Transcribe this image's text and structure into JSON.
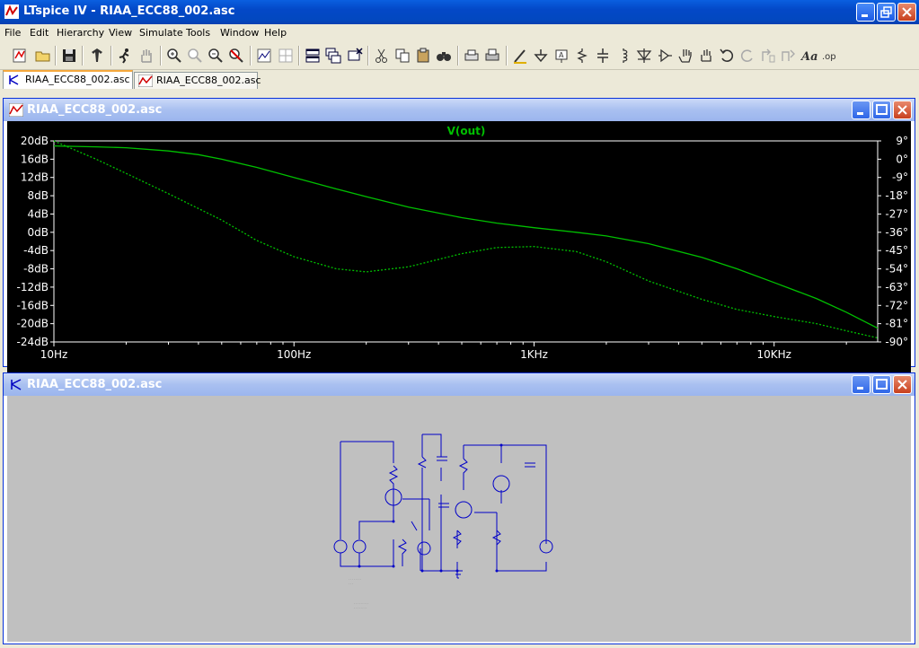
{
  "window": {
    "title": "LTspice IV - RIAA_ECC88_002.asc"
  },
  "menu": [
    "File",
    "Edit",
    "Hierarchy",
    "View",
    "Simulate",
    "Tools",
    "Window",
    "Help"
  ],
  "tabs": [
    {
      "label": "RIAA_ECC88_002.asc",
      "active": true
    },
    {
      "label": "RIAA_ECC88_002.asc",
      "active": false
    }
  ],
  "plot_window": {
    "title": "RIAA_ECC88_002.asc"
  },
  "schematic_window": {
    "title": "RIAA_ECC88_002.asc"
  },
  "colors": {
    "trace": "#00c000",
    "background": "#000000",
    "axis_text": "#ffffff",
    "wire": "#0000c8"
  },
  "chart_data": {
    "type": "line",
    "title": "V(out)",
    "xscale": "log",
    "xlim": [
      10,
      27000
    ],
    "x_ticks": [
      "10Hz",
      "100Hz",
      "1KHz",
      "10KHz"
    ],
    "x_tick_values": [
      10,
      100,
      1000,
      10000
    ],
    "y_ticks": [
      "20dB",
      "16dB",
      "12dB",
      "8dB",
      "4dB",
      "0dB",
      "-4dB",
      "-8dB",
      "-12dB",
      "-16dB",
      "-20dB",
      "-24dB"
    ],
    "ylim": [
      -24,
      20
    ],
    "y2_ticks": [
      "9°",
      "0°",
      "-9°",
      "-18°",
      "-27°",
      "-36°",
      "-45°",
      "-54°",
      "-63°",
      "-72°",
      "-81°",
      "-90°"
    ],
    "y2lim": [
      -90,
      9
    ],
    "grid": false,
    "series": [
      {
        "style": "solid",
        "x": [
          10,
          15,
          20,
          30,
          40,
          50,
          70,
          100,
          150,
          200,
          300,
          500,
          700,
          1000,
          1500,
          2000,
          3000,
          5000,
          7000,
          10000,
          15000,
          20000,
          27000
        ],
        "y": [
          18.9,
          18.7,
          18.5,
          17.8,
          17.0,
          16.0,
          14.2,
          12.0,
          9.5,
          7.8,
          5.5,
          3.2,
          2.0,
          1.0,
          0.0,
          -0.8,
          -2.5,
          -5.5,
          -8.0,
          -11.0,
          -14.5,
          -17.5,
          -21.0
        ]
      },
      {
        "style": "dashed",
        "x": [
          10,
          15,
          20,
          30,
          50,
          70,
          100,
          150,
          200,
          300,
          500,
          700,
          1000,
          1500,
          2000,
          3000,
          5000,
          7000,
          10000,
          15000,
          20000,
          27000
        ],
        "y": [
          9.0,
          0.0,
          -7.0,
          -17.0,
          -30.0,
          -40.0,
          -48.0,
          -54.0,
          -55.5,
          -53.0,
          -46.5,
          -43.5,
          -43.0,
          -45.5,
          -50.5,
          -60.0,
          -69.0,
          -74.0,
          -77.5,
          -81.0,
          -84.5,
          -88.0
        ]
      }
    ]
  }
}
